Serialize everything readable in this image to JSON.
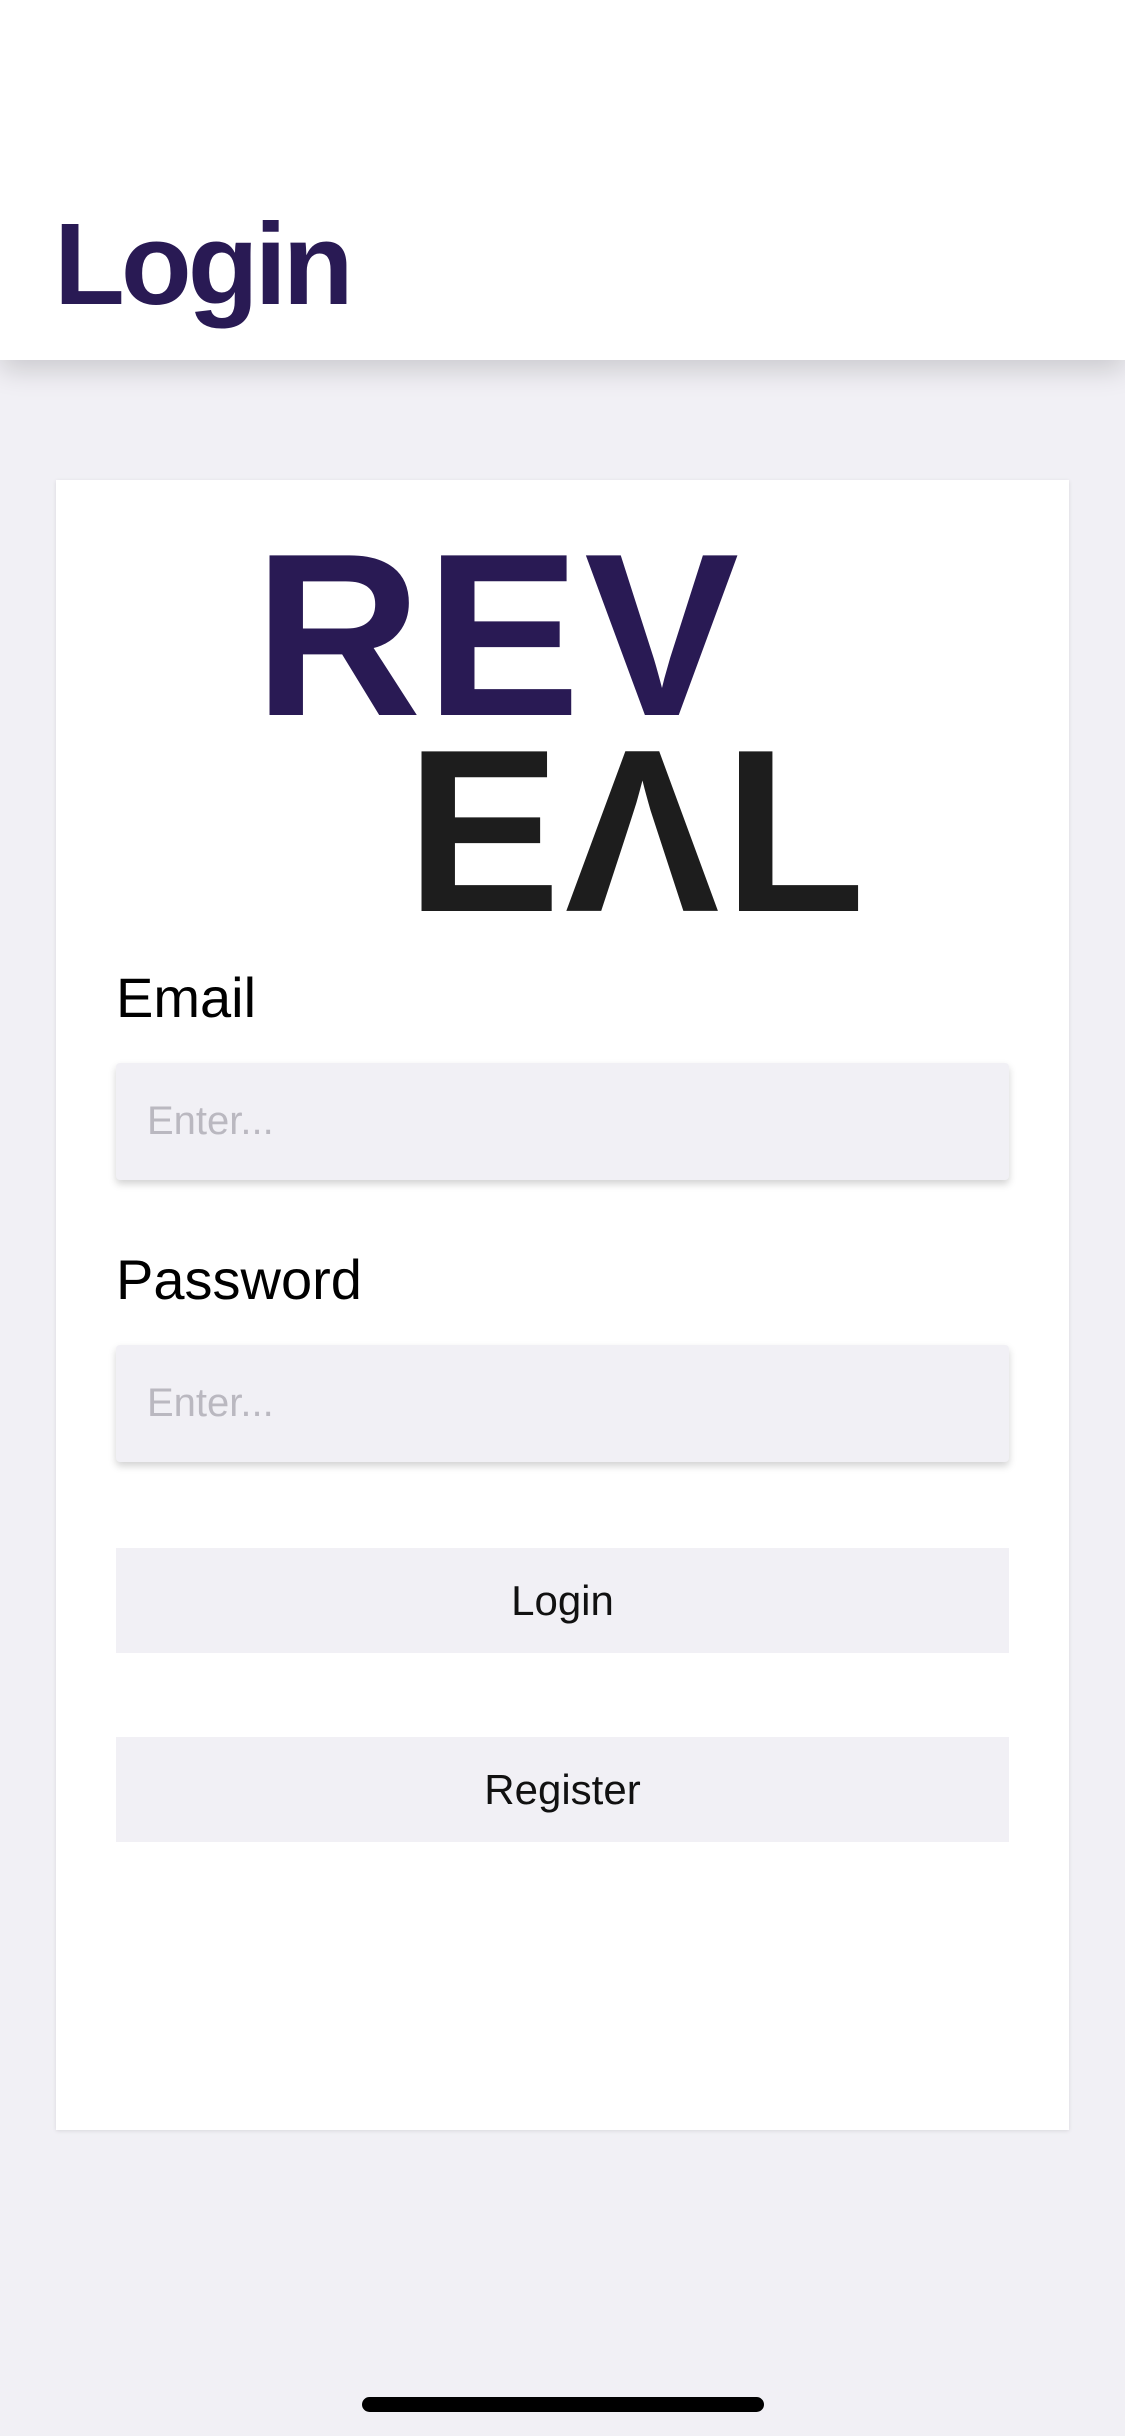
{
  "header": {
    "title": "Login"
  },
  "logo": {
    "line1": "REV",
    "line2": "EΛL"
  },
  "form": {
    "email_label": "Email",
    "email_placeholder": "Enter...",
    "password_label": "Password",
    "password_placeholder": "Enter...",
    "login_label": "Login",
    "register_label": "Register"
  },
  "colors": {
    "brand_purple": "#291a54",
    "logo_dark": "#1d1d1d",
    "background": "#f1f0f5"
  }
}
